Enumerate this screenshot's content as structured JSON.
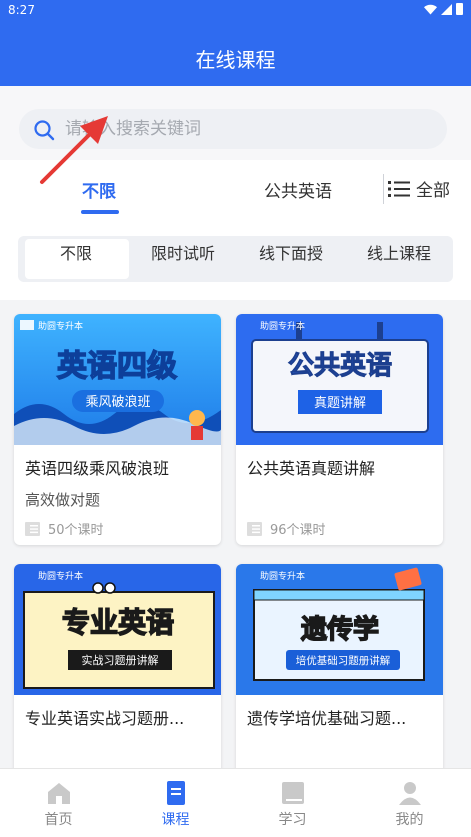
{
  "status": {
    "time": "8:27"
  },
  "header": {
    "title": "在线课程"
  },
  "search": {
    "placeholder": "请输入搜索关键词"
  },
  "category_tabs": {
    "items": [
      "不限",
      "公共英语"
    ],
    "active": "不限",
    "all_label": "全部"
  },
  "filters": {
    "items": [
      "不限",
      "限时试听",
      "线下面授",
      "线上课程"
    ],
    "active": "不限"
  },
  "courses": [
    {
      "title": "英语四级乘风破浪班",
      "subtitle": "高效做对题",
      "count": "50个课时",
      "cover": {
        "brand": "助圆专升本",
        "headline": "英语四级",
        "tagline": "乘风破浪班"
      }
    },
    {
      "title": "公共英语真题讲解",
      "subtitle": "",
      "count": "96个课时",
      "cover": {
        "brand": "助圆专升本",
        "headline": "公共英语",
        "tagline": "真题讲解"
      }
    },
    {
      "title": "专业英语实战习题册...",
      "subtitle": "",
      "count": "",
      "cover": {
        "brand": "助圆专升本",
        "headline": "专业英语",
        "tagline": "实战习题册讲解"
      }
    },
    {
      "title": "遗传学培优基础习题...",
      "subtitle": "",
      "count": "",
      "cover": {
        "brand": "助圆专升本",
        "headline": "遗传学",
        "tagline": "培优基础习题册讲解"
      }
    }
  ],
  "bottom_nav": {
    "items": [
      {
        "label": "首页",
        "icon": "home-icon"
      },
      {
        "label": "课程",
        "icon": "course-book-icon"
      },
      {
        "label": "学习",
        "icon": "study-book-icon"
      },
      {
        "label": "我的",
        "icon": "user-icon"
      }
    ],
    "active": "课程"
  },
  "colors": {
    "primary": "#2f6bf0",
    "annotation_arrow": "#e53935"
  }
}
